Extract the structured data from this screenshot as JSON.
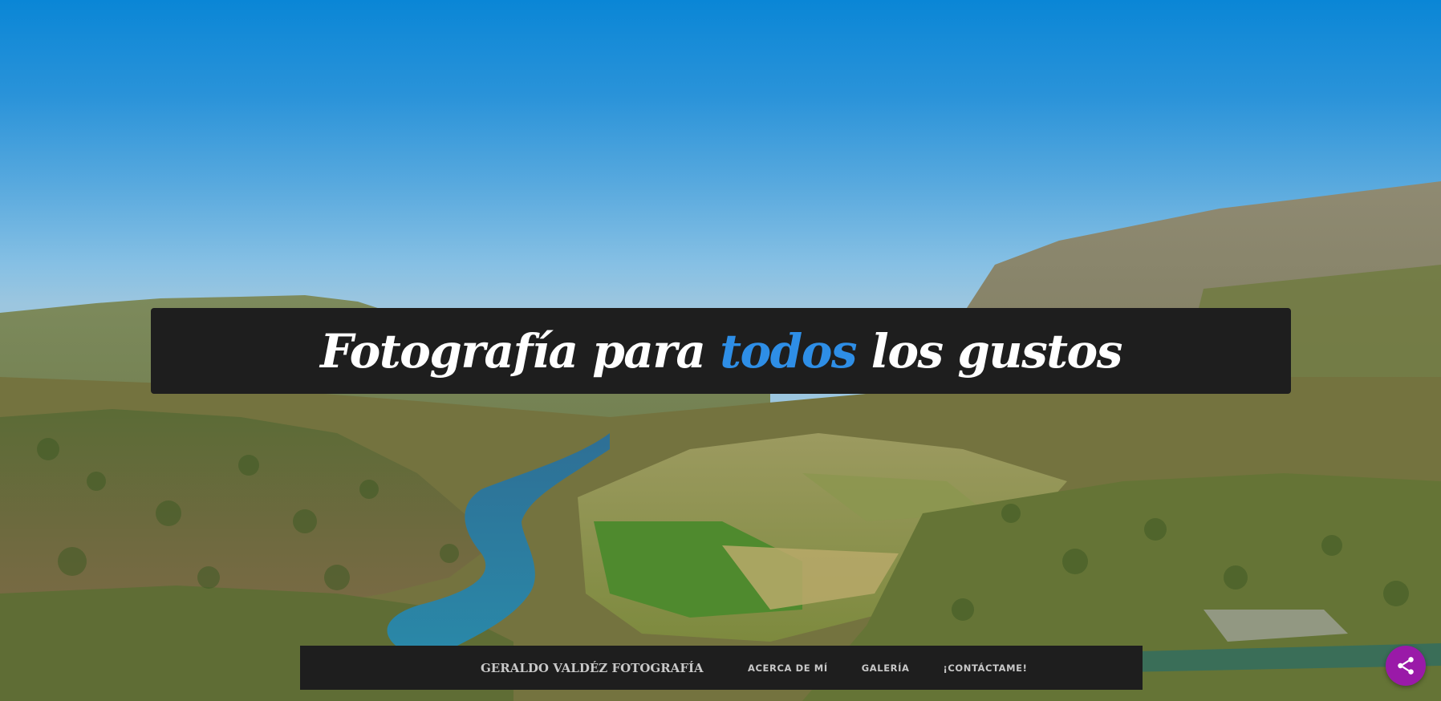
{
  "hero": {
    "title_before": "Fotografía para ",
    "title_accent": "todos",
    "title_after": " los gustos",
    "accent_color": "#2e8ee6"
  },
  "navbar": {
    "brand": "GERALDO VALDÉZ FOTOGRAFÍA",
    "links": [
      {
        "label": "ACERCA DE MÍ"
      },
      {
        "label": "GALERÍA"
      },
      {
        "label": "¡CONTÁCTAME!"
      }
    ]
  },
  "share_button": {
    "icon": "share-icon",
    "color": "#9a1aa8"
  }
}
